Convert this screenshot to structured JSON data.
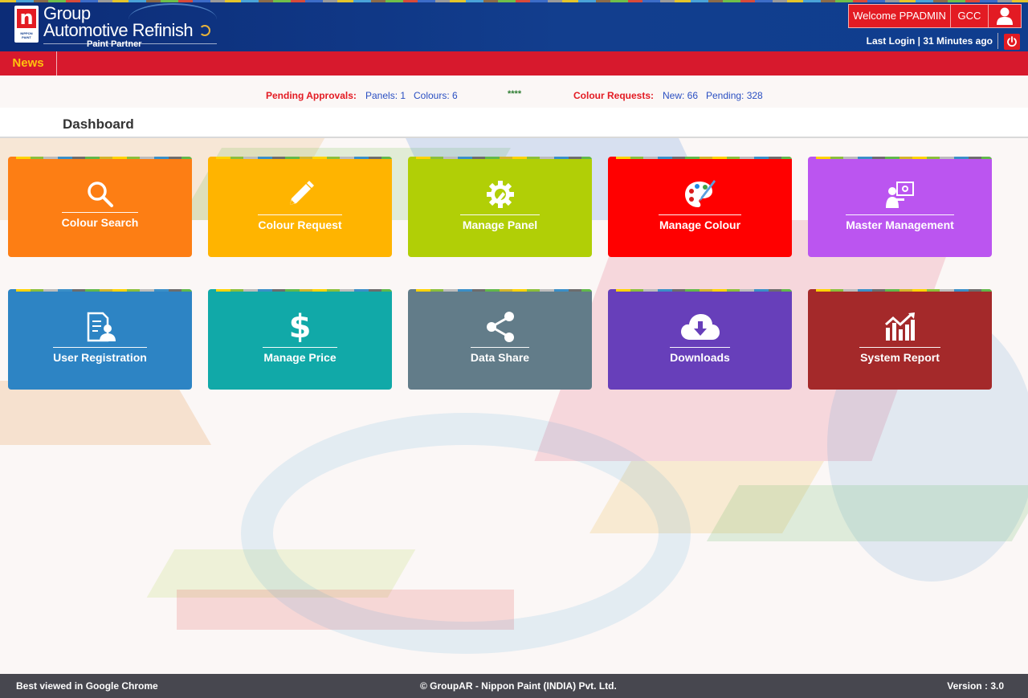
{
  "header": {
    "logo_letter": "n",
    "logo_caption": "NIPPON PAINT",
    "brand_line1": "Group",
    "brand_line2": "Automotive Refinish",
    "brand_line3": "Paint Partner",
    "welcome": "Welcome PPADMIN",
    "region": "GCC",
    "last_login": "Last Login | 31 Minutes ago",
    "user_icon": "user-icon",
    "power_icon": "power-icon"
  },
  "news": {
    "label": "News"
  },
  "pending": {
    "approvals_label": "Pending Approvals:",
    "panels": "Panels: 1",
    "colours": "Colours: 6",
    "separator": "****",
    "requests_label": "Colour Requests:",
    "new": "New: 66",
    "pending": "Pending: 328"
  },
  "dashboard": {
    "title": "Dashboard",
    "tiles": [
      {
        "label": "Colour Search",
        "icon": "search-icon",
        "color": "#fd7e14"
      },
      {
        "label": "Colour Request",
        "icon": "pencil-icon",
        "color": "#ffb400"
      },
      {
        "label": "Manage Panel",
        "icon": "gear-wrench-icon",
        "color": "#b1cf06"
      },
      {
        "label": "Manage Colour",
        "icon": "palette-icon",
        "color": "#ff0000"
      },
      {
        "label": "Master Management",
        "icon": "presenter-gear-icon",
        "color": "#bb55f0"
      },
      {
        "label": "User Registration",
        "icon": "user-document-icon",
        "color": "#2d84c4"
      },
      {
        "label": "Manage Price",
        "icon": "dollar-icon",
        "color": "#11a9a8"
      },
      {
        "label": "Data Share",
        "icon": "share-icon",
        "color": "#627c89"
      },
      {
        "label": "Downloads",
        "icon": "cloud-download-icon",
        "color": "#673fba"
      },
      {
        "label": "System Report",
        "icon": "chart-report-icon",
        "color": "#a4292a"
      }
    ]
  },
  "footer": {
    "left": "Best viewed in Google Chrome",
    "center": "© GroupAR - Nippon Paint (INDIA) Pvt. Ltd.",
    "right": "Version : 3.0"
  }
}
